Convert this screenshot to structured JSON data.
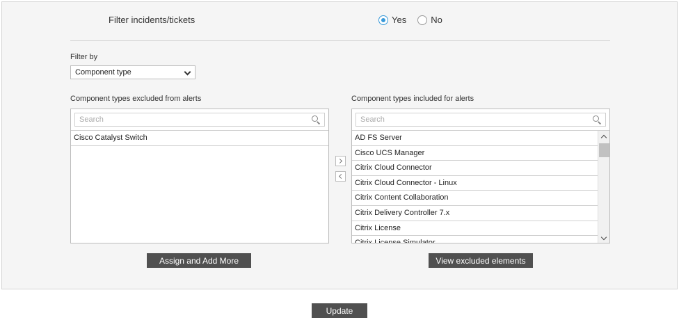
{
  "filter_incidents": {
    "label": "Filter incidents/tickets",
    "options": [
      {
        "label": "Yes",
        "checked": true
      },
      {
        "label": "No",
        "checked": false
      }
    ]
  },
  "filter_by": {
    "label": "Filter by",
    "selected": "Component type"
  },
  "excluded": {
    "label": "Component types excluded from alerts",
    "search_placeholder": "Search",
    "items": [
      "Cisco Catalyst Switch"
    ]
  },
  "included": {
    "label": "Component types included for alerts",
    "search_placeholder": "Search",
    "items": [
      "AD FS Server",
      "Cisco UCS Manager",
      "Citrix Cloud Connector",
      "Citrix Cloud Connector - Linux",
      "Citrix Content Collaboration",
      "Citrix Delivery Controller 7.x",
      "Citrix License",
      "Citrix License Simulator"
    ]
  },
  "buttons": {
    "assign": "Assign and Add More",
    "view_excluded": "View excluded elements",
    "update": "Update"
  },
  "colors": {
    "accent": "#3a9ad9",
    "button_bg": "#505050",
    "panel_bg": "#f5f5f5"
  }
}
